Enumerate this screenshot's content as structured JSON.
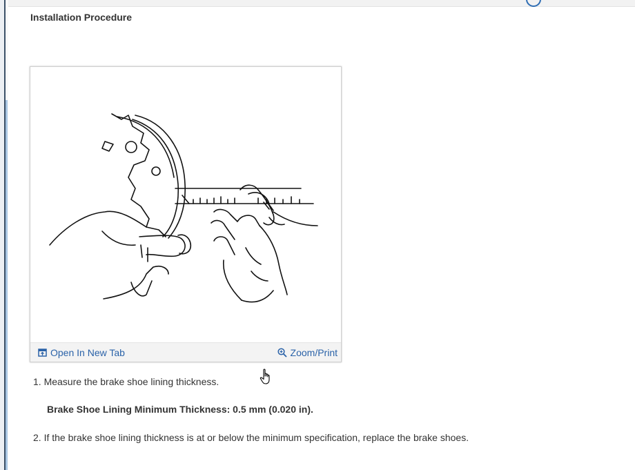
{
  "section": {
    "title": "Installation Procedure"
  },
  "figure": {
    "open_tab_label": "Open In New Tab",
    "open_tab_icon": "open-in-new-tab-icon",
    "zoom_label": "Zoom/Print",
    "zoom_icon": "magnifier-icon"
  },
  "steps": [
    {
      "text": "1. Measure the brake shoe lining thickness."
    },
    {
      "text": "2. If the brake shoe lining thickness is at or below the minimum specification, replace the brake shoes."
    }
  ],
  "spec": {
    "text": "Brake Shoe Lining Minimum Thickness: 0.5 mm (0.020 in)."
  },
  "colors": {
    "link": "#2a62a8",
    "text": "#333333",
    "rail": "#3a4f66"
  }
}
